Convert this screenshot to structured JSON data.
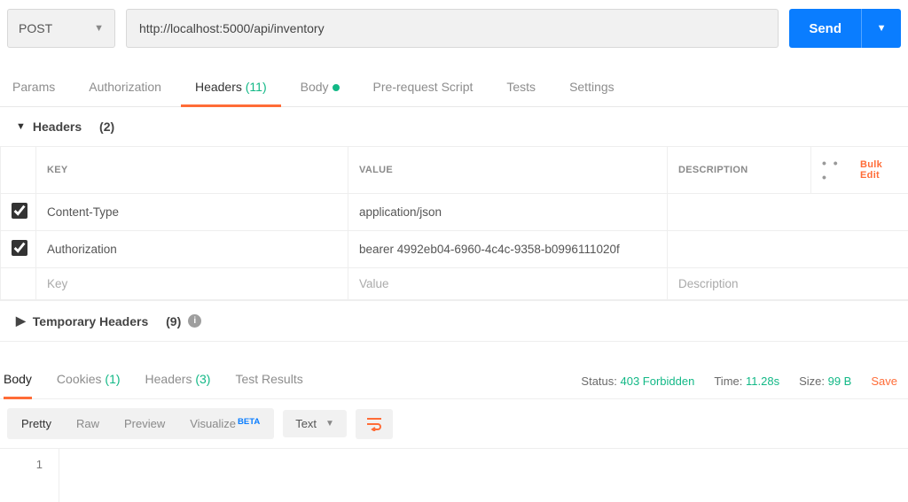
{
  "request": {
    "method": "POST",
    "url": "http://localhost:5000/api/inventory",
    "send_label": "Send"
  },
  "tabs": {
    "params": "Params",
    "authorization": "Authorization",
    "headers": "Headers",
    "headers_count": "(11)",
    "body": "Body",
    "prerequest": "Pre-request Script",
    "tests": "Tests",
    "settings": "Settings"
  },
  "section": {
    "headers_title": "Headers",
    "headers_count": "(2)"
  },
  "table": {
    "col_key": "KEY",
    "col_value": "VALUE",
    "col_desc": "DESCRIPTION",
    "bulk_edit": "Bulk Edit",
    "more": "• • •",
    "rows": [
      {
        "key": "Content-Type",
        "value": "application/json",
        "desc": ""
      },
      {
        "key": "Authorization",
        "value": "bearer 4992eb04-6960-4c4c-9358-b0996111020f",
        "desc": ""
      }
    ],
    "ph_key": "Key",
    "ph_value": "Value",
    "ph_desc": "Description"
  },
  "temp_headers": {
    "title": "Temporary Headers",
    "count": "(9)"
  },
  "response_tabs": {
    "body": "Body",
    "cookies": "Cookies",
    "cookies_count": "(1)",
    "headers": "Headers",
    "headers_count": "(3)",
    "tests": "Test Results"
  },
  "response": {
    "status_label": "Status:",
    "status_value": "403 Forbidden",
    "time_label": "Time:",
    "time_value": "11.28s",
    "size_label": "Size:",
    "size_value": "99 B",
    "save": "Save"
  },
  "viewer": {
    "pretty": "Pretty",
    "raw": "Raw",
    "preview": "Preview",
    "visualize": "Visualize",
    "beta": "BETA",
    "content_type": "Text",
    "line1": "1"
  }
}
